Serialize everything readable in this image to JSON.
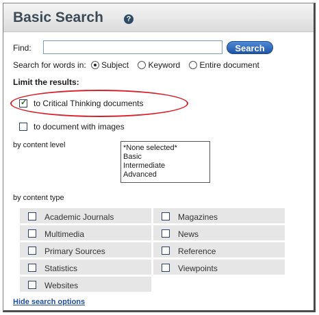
{
  "header": {
    "title": "Basic Search",
    "help_icon": "?"
  },
  "find": {
    "label": "Find:",
    "value": "",
    "button": "Search"
  },
  "search_words": {
    "label": "Search for words in:",
    "options": [
      "Subject",
      "Keyword",
      "Entire document"
    ],
    "selected": "Subject"
  },
  "limit": {
    "heading": "Limit the results:",
    "critical_thinking": {
      "label": "to Critical Thinking documents",
      "checked": true
    },
    "with_images": {
      "label": "to document with images",
      "checked": false
    }
  },
  "content_level": {
    "label": "by content level",
    "options": [
      "*None selected*",
      "Basic",
      "Intermediate",
      "Advanced"
    ]
  },
  "content_type": {
    "label": "by content type",
    "items": [
      "Academic Journals",
      "Magazines",
      "Multimedia",
      "News",
      "Primary Sources",
      "Reference",
      "Statistics",
      "Viewpoints",
      "Websites"
    ]
  },
  "hide_link": "Hide search options",
  "colors": {
    "title": "#3d4a56",
    "button": "#1f55a6",
    "highlight": "#d8202a",
    "link": "#1f4e9a"
  }
}
